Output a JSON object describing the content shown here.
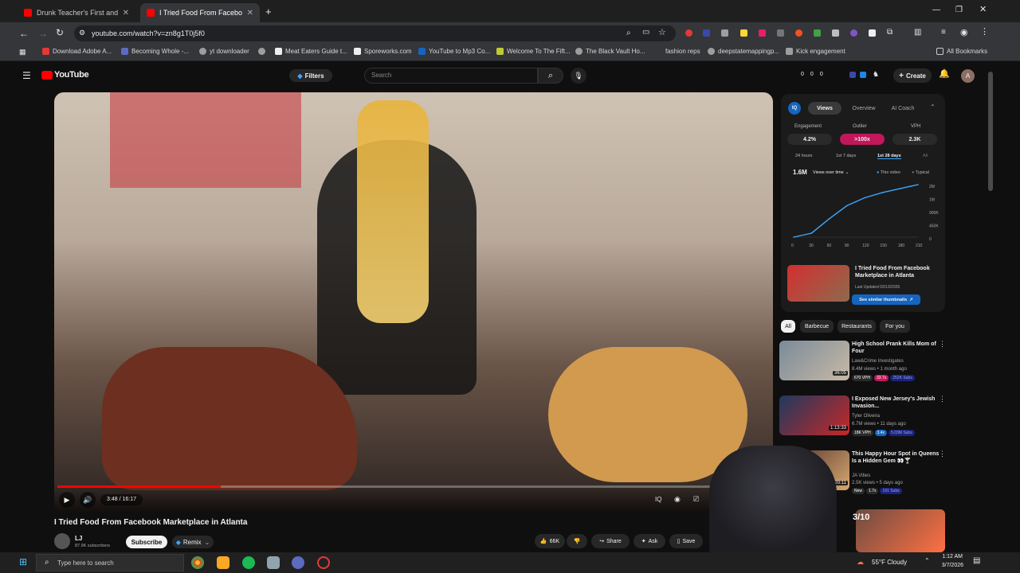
{
  "browser": {
    "tabs": [
      {
        "title": "Drunk Teacher's First and Last L"
      },
      {
        "title": "I Tried Food From Facebook M"
      }
    ],
    "url": "youtube.com/watch?v=zn8g1T0j5f0",
    "bookmarks": [
      "Download Adobe A...",
      "Becoming Whole -...",
      "yt downloader",
      "",
      "Meat Eaters Guide t...",
      "Sporeworks.com",
      "YouTube to Mp3 Co...",
      "Welcome To The Fift...",
      "The Black Vault Ho...",
      "fashion reps",
      "deepstatemappingp...",
      "Kick engagement"
    ],
    "all_bookmarks": "All Bookmarks"
  },
  "youtube": {
    "logo": "YouTube",
    "filters": "Filters",
    "search_placeholder": "Search",
    "counters": [
      "0",
      "0",
      "0"
    ],
    "create": "Create",
    "avatar_letter": "A"
  },
  "player": {
    "time": "3:48 / 16:17",
    "progress": 0.233
  },
  "video": {
    "title": "I Tried Food From Facebook Marketplace in Atlanta",
    "channel": "LJ",
    "subscribers": "87.9K subscribers",
    "subscribe": "Subscribe",
    "remix": "Remix",
    "likes": "66K",
    "share": "Share",
    "ask": "Ask",
    "save": "Save"
  },
  "analytics": {
    "tabs": [
      "Views",
      "Overview",
      "AI Coach"
    ],
    "metrics": [
      {
        "label": "Engagement",
        "value": "4.2%"
      },
      {
        "label": "Outlier",
        "value": ">100x"
      },
      {
        "label": "VPH",
        "value": "2.3K"
      }
    ],
    "ranges": [
      "24 hours",
      "1st 7 days",
      "1st 28 days",
      "All"
    ],
    "total": "1.6M",
    "views_over_time": "Views over time",
    "legend": [
      "This video",
      "Typical"
    ],
    "thumb_title": "I Tried Food From Facebook Marketplace in Atlanta",
    "thumb_updated": "Last Updated 03/13/2026",
    "similar": "See similar thumbnails"
  },
  "chart_data": {
    "type": "line",
    "x": [
      0,
      30,
      60,
      90,
      120,
      150,
      180,
      210
    ],
    "series": [
      {
        "name": "This video",
        "values": [
          0,
          150000,
          700000,
          1200000,
          1500000,
          1700000,
          1850000,
          2000000
        ]
      }
    ],
    "x_ticks": [
      "0",
      "30",
      "60",
      "90",
      "120",
      "150",
      "180",
      "210"
    ],
    "y_ticks": [
      "2M",
      "1M",
      "900K",
      "450K",
      "0"
    ],
    "ylim": [
      0,
      2000000
    ]
  },
  "chips": [
    "All",
    "Barbecue",
    "Restaurants",
    "For you"
  ],
  "recommendations": [
    {
      "title": "High School Prank Kills Mom of Four",
      "channel": "Law&Crime Investigates",
      "meta": "8.4M views • 1 month ago",
      "duration": "36:05",
      "badges": [
        "670 VPH",
        "33.7x",
        "252K Subs"
      ]
    },
    {
      "title": "I Exposed New Jersey's Jewish Invasion...",
      "channel": "Tyler Oliveira",
      "meta": "6.7M views • 11 days ago",
      "duration": "1:13:33",
      "badges": [
        "18K VPH",
        "3.4x",
        "5.03M Subs"
      ]
    },
    {
      "title": "This Happy Hour Spot in Queens Is a Hidden Gem 👀🍸",
      "channel": "JA Vibes",
      "meta": "2.5K views • 5 days ago",
      "duration": "20:11",
      "badges": [
        "New",
        "1.7x",
        "191 Subs"
      ]
    },
    {
      "title": "",
      "channel": "",
      "meta": "",
      "duration": "3/10",
      "badges": []
    }
  ],
  "taskbar": {
    "search": "Type here to search",
    "weather": "55°F Cloudy",
    "time": "1:12 AM",
    "date": "3/7/2026"
  },
  "colors": {
    "accent_red": "#ff0000",
    "outlier": "#c2185b",
    "link_blue": "#3ea6ff"
  }
}
